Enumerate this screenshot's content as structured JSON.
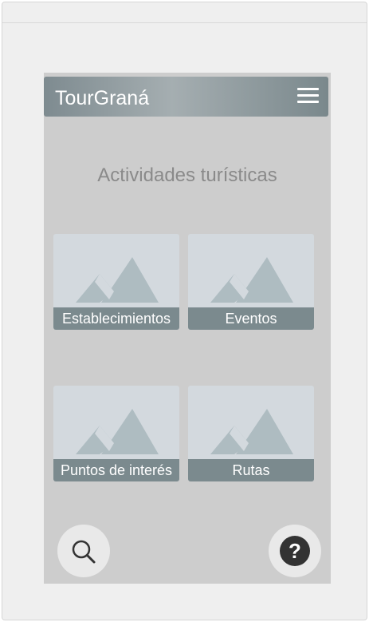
{
  "app": {
    "title": "TourGraná",
    "menu_icon": "hamburger-menu-icon"
  },
  "page": {
    "heading": "Actividades turísticas"
  },
  "tiles": [
    {
      "label": "Establecimientos",
      "icon": "image-placeholder-icon"
    },
    {
      "label": "Eventos",
      "icon": "image-placeholder-icon"
    },
    {
      "label": "Puntos de interés",
      "icon": "image-placeholder-icon"
    },
    {
      "label": "Rutas",
      "icon": "image-placeholder-icon"
    }
  ],
  "actions": {
    "search_icon": "search-icon",
    "help_icon": "help-icon"
  },
  "colors": {
    "screen_background": "#cdcdcd",
    "header": "#8a979b",
    "tile_label_background": "#7b8a8e",
    "tile_placeholder": "#d3d9de",
    "mountain": "#aebcc1",
    "heading_text": "#8a8a8a"
  }
}
